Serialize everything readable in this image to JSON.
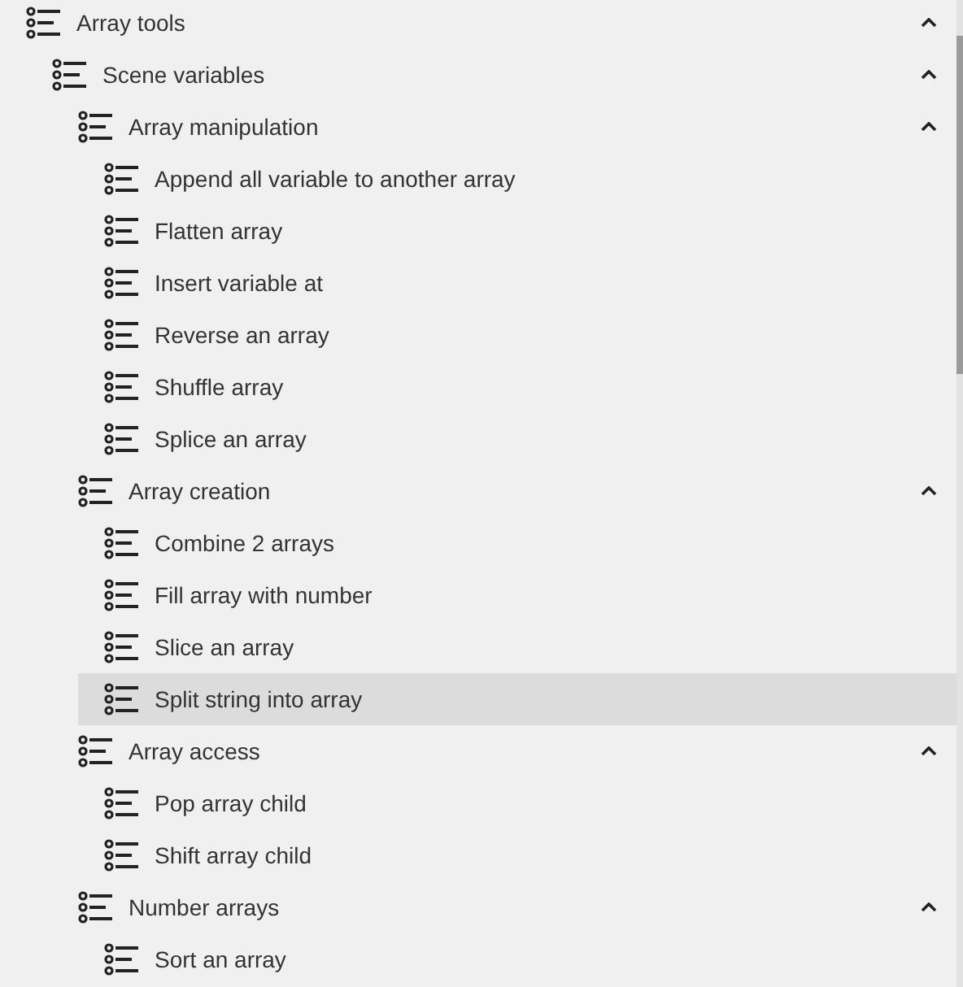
{
  "tree": [
    {
      "label": "Array tools",
      "selected": false,
      "expanded": true,
      "children": [
        {
          "label": "Scene variables",
          "selected": false,
          "expanded": true,
          "children": [
            {
              "label": "Array manipulation",
              "selected": false,
              "expanded": true,
              "children": [
                {
                  "label": "Append all variable to another array",
                  "selected": false
                },
                {
                  "label": "Flatten array",
                  "selected": false
                },
                {
                  "label": "Insert variable at",
                  "selected": false
                },
                {
                  "label": "Reverse an array",
                  "selected": false
                },
                {
                  "label": "Shuffle array",
                  "selected": false
                },
                {
                  "label": "Splice an array",
                  "selected": false
                }
              ]
            },
            {
              "label": "Array creation",
              "selected": false,
              "expanded": true,
              "children": [
                {
                  "label": "Combine 2 arrays",
                  "selected": false
                },
                {
                  "label": "Fill array with number",
                  "selected": false
                },
                {
                  "label": "Slice an array",
                  "selected": false
                },
                {
                  "label": "Split string into array",
                  "selected": true
                }
              ]
            },
            {
              "label": "Array access",
              "selected": false,
              "expanded": true,
              "children": [
                {
                  "label": "Pop array child",
                  "selected": false
                },
                {
                  "label": "Shift array child",
                  "selected": false
                }
              ]
            },
            {
              "label": "Number arrays",
              "selected": false,
              "expanded": true,
              "children": [
                {
                  "label": "Sort an array",
                  "selected": false
                }
              ]
            }
          ]
        }
      ]
    }
  ]
}
